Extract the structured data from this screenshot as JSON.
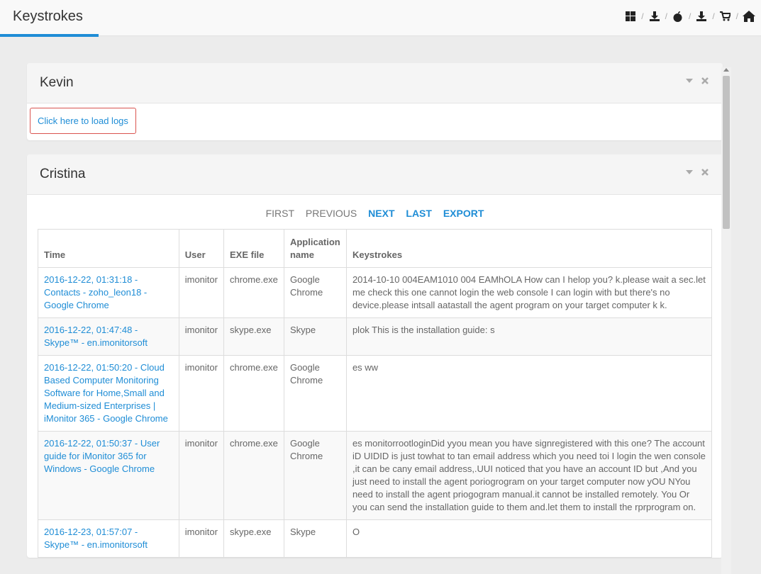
{
  "header": {
    "title": "Keystrokes",
    "separator": "/",
    "icons": [
      "windows-icon",
      "download-icon",
      "apple-icon",
      "download-icon",
      "cart-icon",
      "home-icon"
    ]
  },
  "panels": {
    "kevin": {
      "name": "Kevin",
      "load_label": "Click here to load logs"
    },
    "cristina": {
      "name": "Cristina",
      "pager": {
        "first": "FIRST",
        "previous": "PREVIOUS",
        "next": "NEXT",
        "last": "LAST",
        "export": "EXPORT"
      },
      "columns": {
        "time": "Time",
        "user": "User",
        "exe": "EXE file",
        "app": "Application name",
        "keys": "Keystrokes"
      },
      "rows": [
        {
          "time": "2016-12-22, 01:31:18 - Contacts - zoho_leon18 - Google Chrome",
          "user": "imonitor",
          "exe": "chrome.exe",
          "app": "Google Chrome",
          "keys": "2014-10-10 004EAM1010 004 EAMhOLA How can I helop you? k.please wait a sec.let me check this one cannot login the web console I can login with but there's no device.please intsall aatastall the agent program on your target computer k k."
        },
        {
          "time": "2016-12-22, 01:47:48 - Skype™ - en.imonitorsoft",
          "user": "imonitor",
          "exe": "skype.exe",
          "app": "Skype",
          "keys": "plok This is the installation guide: s"
        },
        {
          "time": "2016-12-22, 01:50:20 - Cloud Based Computer Monitoring Software for Home,Small and Medium-sized Enterprises | iMonitor 365 - Google Chrome",
          "user": "imonitor",
          "exe": "chrome.exe",
          "app": "Google Chrome",
          "keys": "es ww"
        },
        {
          "time": "2016-12-22, 01:50:37 - User guide for iMonitor 365 for Windows - Google Chrome",
          "user": "imonitor",
          "exe": "chrome.exe",
          "app": "Google Chrome",
          "keys": "es monitorrootloginDid yyou mean you have signregistered with this one? The account iD UIDID is just towhat to tan email address which you need toi I login the wen console ,it can be cany email address,.UUI noticed that you have an account ID but ,And you just need to install the agent poriogrogram on your target computer now yOU NYou need to install the agent priogogram manual.it cannot be installed remotely. You Or you can send the installation guide to them and.let them to install the rprprogram on."
        },
        {
          "time": "2016-12-23, 01:57:07 - Skype™ - en.imonitorsoft",
          "user": "imonitor",
          "exe": "skype.exe",
          "app": "Skype",
          "keys": "O"
        }
      ]
    }
  }
}
